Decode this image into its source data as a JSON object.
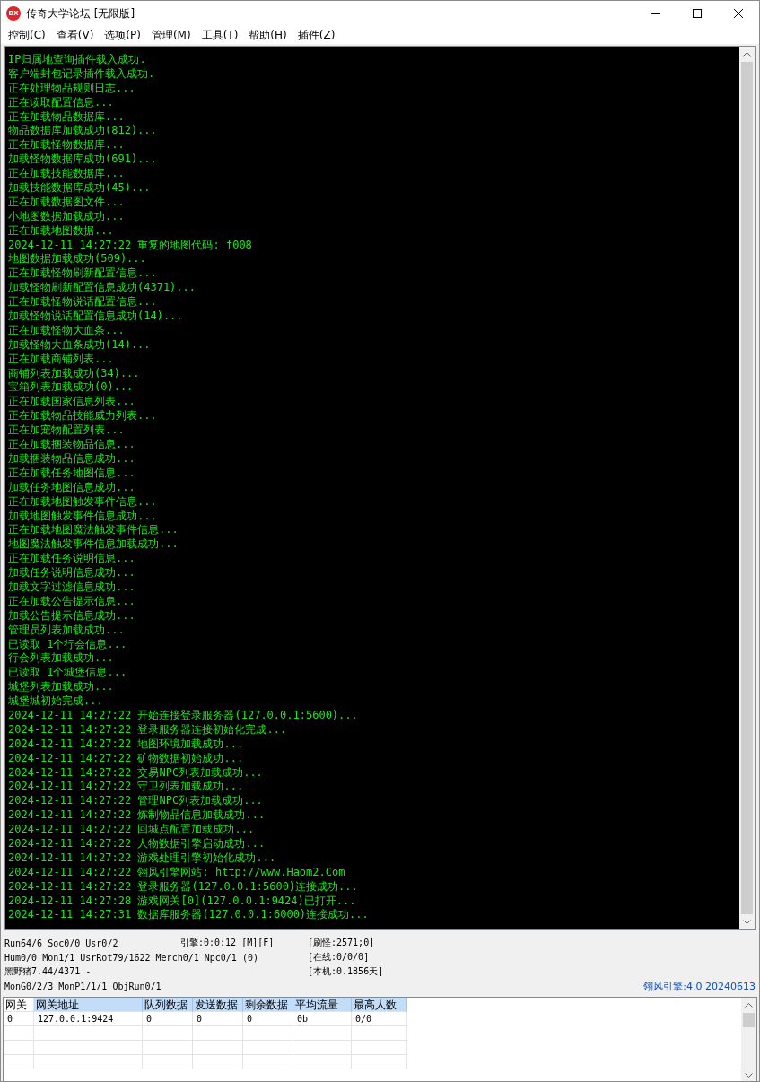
{
  "window": {
    "title": "传奇大学论坛 [无限版]",
    "app_icon_text": "DX"
  },
  "menu": [
    "控制(C)",
    "查看(V)",
    "选项(P)",
    "管理(M)",
    "工具(T)",
    "帮助(H)",
    "插件(Z)"
  ],
  "log": [
    "IP归属地查询插件载入成功.",
    "客户端封包记录插件载入成功.",
    "正在处理物品规则日志...",
    "正在读取配置信息...",
    "正在加载物品数据库...",
    "物品数据库加载成功(812)...",
    "正在加载怪物数据库...",
    "加载怪物数据库成功(691)...",
    "正在加载技能数据库...",
    "加载技能数据库成功(45)...",
    "正在加载数据图文件...",
    "小地图数据加载成功...",
    "正在加载地图数据...",
    "2024-12-11 14:27:22 重复的地图代码: f008",
    "地图数据加载成功(509)...",
    "正在加载怪物刷新配置信息...",
    "加载怪物刷新配置信息成功(4371)...",
    "正在加载怪物说话配置信息...",
    "加载怪物说话配置信息成功(14)...",
    "正在加载怪物大血条...",
    "加载怪物大血条成功(14)...",
    "正在加载商铺列表...",
    "商铺列表加载成功(34)...",
    "宝箱列表加载成功(0)...",
    "正在加载国家信息列表...",
    "正在加载物品技能威力列表...",
    "正在加宠物配置列表...",
    "正在加载捆装物品信息...",
    "加载捆装物品信息成功...",
    "正在加载任务地图信息...",
    "加载任务地图信息成功...",
    "正在加载地图触发事件信息...",
    "加载地图触发事件信息成功...",
    "正在加载地图魔法触发事件信息...",
    "地图魔法触发事件信息加载成功...",
    "正在加载任务说明信息...",
    "加载任务说明信息成功...",
    "加载文字过滤信息成功...",
    "正在加载公告提示信息...",
    "加载公告提示信息成功...",
    "管理员列表加载成功...",
    "已读取 1个行会信息...",
    "行会列表加载成功...",
    "已读取 1个城堡信息...",
    "城堡列表加载成功...",
    "城堡城初始完成...",
    "2024-12-11 14:27:22 开始连接登录服务器(127.0.0.1:5600)...",
    "2024-12-11 14:27:22 登录服务器连接初始化完成...",
    "2024-12-11 14:27:22 地图环境加载成功...",
    "2024-12-11 14:27:22 矿物数据初始成功...",
    "2024-12-11 14:27:22 交易NPC列表加载成功...",
    "2024-12-11 14:27:22 守卫列表加载成功...",
    "2024-12-11 14:27:22 管理NPC列表加载成功...",
    "2024-12-11 14:27:22 炼制物品信息加载成功...",
    "2024-12-11 14:27:22 回城点配置加载成功...",
    "2024-12-11 14:27:22 人物数据引擎启动成功...",
    "2024-12-11 14:27:22 游戏处理引擎初始化成功...",
    "2024-12-11 14:27:22 翎风引擎网站: http://www.Haom2.Com",
    "2024-12-11 14:27:22 登录服务器(127.0.0.1:5600)连接成功...",
    "2024-12-11 14:27:28 游戏网关[0](127.0.0.1:9424)已打开...",
    "2024-12-11 14:27:31 数据库服务器(127.0.0.1:6000)连接成功..."
  ],
  "status_lines": [
    {
      "left": "Run64/6 Soc0/0 Usr0/2",
      "middle": "引擎:0:0:12 [M][F]",
      "right": "[刷怪:2571;0]"
    },
    {
      "left": "Hum0/0 Mon1/1 UsrRot79/1622 Merch0/1 Npc0/1 (0)",
      "right": "[在线:0/0/0]"
    },
    {
      "left": "黑野猪7,44/4371 -",
      "right": "[本机:0.1856天]"
    },
    {
      "left": "MonG0/2/3 MonP1/1/1 ObjRun0/1",
      "version": "翎风引擎:4.0 20240613"
    }
  ],
  "table": {
    "columns": [
      {
        "label": "网关",
        "highlighted": false
      },
      {
        "label": "网关地址",
        "highlighted": true
      },
      {
        "label": "队列数据",
        "highlighted": true
      },
      {
        "label": "发送数据",
        "highlighted": true
      },
      {
        "label": "剩余数据",
        "highlighted": true
      },
      {
        "label": "平均流量",
        "highlighted": true
      },
      {
        "label": "最高人数",
        "highlighted": true
      }
    ],
    "rows": [
      [
        "0",
        "127.0.0.1:9424",
        "0",
        "0",
        "0",
        "0b",
        "0/0"
      ]
    ]
  }
}
